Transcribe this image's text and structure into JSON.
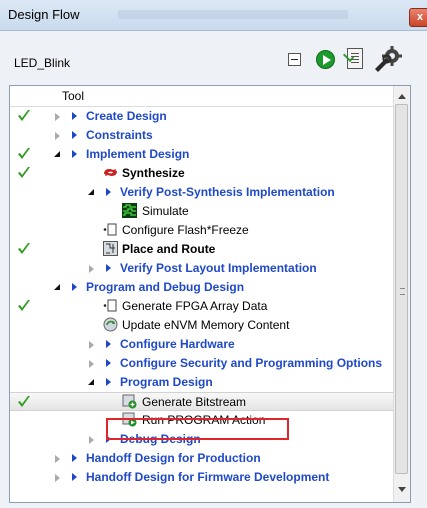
{
  "window": {
    "title": "Design Flow",
    "close_label": "x"
  },
  "toolbar": {
    "project_name": "LED_Blink",
    "buttons": [
      "collapse-all",
      "run",
      "report",
      "options"
    ]
  },
  "tree": {
    "column_header": "Tool",
    "rows": [
      {
        "label": "Create Design",
        "type": "category",
        "check": true
      },
      {
        "label": "Constraints",
        "type": "category",
        "check": false
      },
      {
        "label": "Implement Design",
        "type": "category",
        "check": true
      },
      {
        "label": "Synthesize",
        "type": "tool-bold",
        "check": true
      },
      {
        "label": "Verify Post-Synthesis Implementation",
        "type": "category",
        "check": false
      },
      {
        "label": "Simulate",
        "type": "tool",
        "check": false
      },
      {
        "label": "Configure Flash*Freeze",
        "type": "tool",
        "check": false
      },
      {
        "label": "Place and Route",
        "type": "tool-bold",
        "check": true
      },
      {
        "label": "Verify Post Layout Implementation",
        "type": "category",
        "check": false
      },
      {
        "label": "Program and Debug Design",
        "type": "category",
        "check": false
      },
      {
        "label": "Generate FPGA Array Data",
        "type": "tool",
        "check": true
      },
      {
        "label": "Update eNVM Memory Content",
        "type": "tool",
        "check": false
      },
      {
        "label": "Configure Hardware",
        "type": "category",
        "check": false
      },
      {
        "label": "Configure Security and Programming Options",
        "type": "category",
        "check": false
      },
      {
        "label": "Program Design",
        "type": "category",
        "check": false
      },
      {
        "label": "Generate Bitstream",
        "type": "tool",
        "check": true
      },
      {
        "label": "Run PROGRAM Action",
        "type": "tool",
        "check": false
      },
      {
        "label": "Debug Design",
        "type": "category",
        "check": false
      },
      {
        "label": "Handoff Design for Production",
        "type": "category",
        "check": false
      },
      {
        "label": "Handoff Design for Firmware Development",
        "type": "category",
        "check": false
      }
    ]
  },
  "colors": {
    "category": "#1f49c8",
    "check": "#2f9a1f",
    "highlight": "#e0262a"
  }
}
